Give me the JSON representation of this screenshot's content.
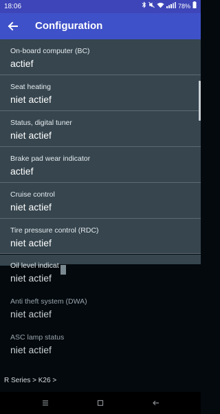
{
  "status_bar": {
    "time": "18:06",
    "battery": "78%"
  },
  "app_bar": {
    "title": "Configuration",
    "back_icon": "arrow-back-icon"
  },
  "items": [
    {
      "label": "On-board computer (BC)",
      "value": "actief"
    },
    {
      "label": "Seat heating",
      "value": "niet actief"
    },
    {
      "label": "Status, digital tuner",
      "value": "niet actief"
    },
    {
      "label": "Brake pad wear indicator",
      "value": "actief"
    },
    {
      "label": "Cruise control",
      "value": "niet actief"
    },
    {
      "label": "Tire pressure control (RDC)",
      "value": "niet actief"
    },
    {
      "label": "Oil level indicat",
      "value": "niet actief"
    },
    {
      "label": "Anti theft system (DWA)",
      "value": "niet actief"
    },
    {
      "label": "ASC lamp status",
      "value": "niet actief"
    }
  ],
  "breadcrumb": "R Series > K26 >",
  "colors": {
    "status_bar": "#3d45b8",
    "app_bar": "#3f51c8",
    "list_bg": "#36454e",
    "screen_bg": "#03090d"
  },
  "nav_icons": [
    "recent-apps-icon",
    "home-icon",
    "back-icon"
  ]
}
